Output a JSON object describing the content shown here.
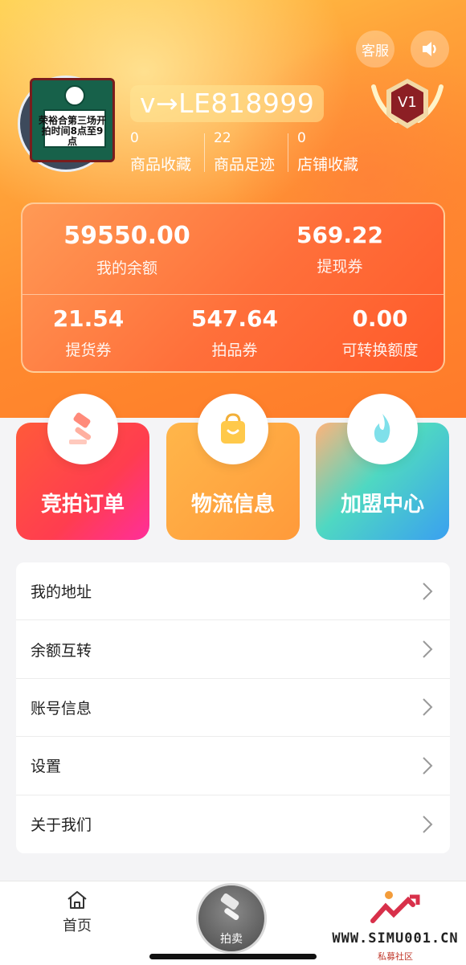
{
  "header": {
    "service_label": "客服",
    "sound_icon": "speaker-icon",
    "username": "v→LE818999",
    "level_badge": "V1",
    "avatar_caption": "荣裕合第三场开拍时间8点至9点",
    "stats": [
      {
        "count": "0",
        "label": "商品收藏"
      },
      {
        "count": "22",
        "label": "商品足迹"
      },
      {
        "count": "0",
        "label": "店铺收藏"
      }
    ]
  },
  "wallet": {
    "balance": {
      "value": "59550.00",
      "label": "我的余额"
    },
    "withdraw": {
      "value": "569.22",
      "label": "提现券"
    },
    "pickup": {
      "value": "21.54",
      "label": "提货券"
    },
    "auction": {
      "value": "547.64",
      "label": "拍品券"
    },
    "convertible": {
      "value": "0.00",
      "label": "可转换额度"
    }
  },
  "quick_cards": [
    {
      "label": "竞拍订单",
      "icon": "gavel-icon"
    },
    {
      "label": "物流信息",
      "icon": "shopping-bag-icon"
    },
    {
      "label": "加盟中心",
      "icon": "flame-icon"
    }
  ],
  "menu": [
    {
      "label": "我的地址"
    },
    {
      "label": "余额互转"
    },
    {
      "label": "账号信息"
    },
    {
      "label": "设置"
    },
    {
      "label": "关于我们"
    }
  ],
  "tabbar": {
    "home_label": "首页",
    "auction_label": "拍卖"
  },
  "watermark": {
    "site": "WWW.SIMU001.CN",
    "sub": "私募社区"
  },
  "colors": {
    "hero_top": "#ffcf4a",
    "hero_bottom": "#ff7a2a",
    "card_red": "#ff3d4f",
    "card_orange": "#ff9a3a",
    "card_teal": "#4fd8c2"
  }
}
